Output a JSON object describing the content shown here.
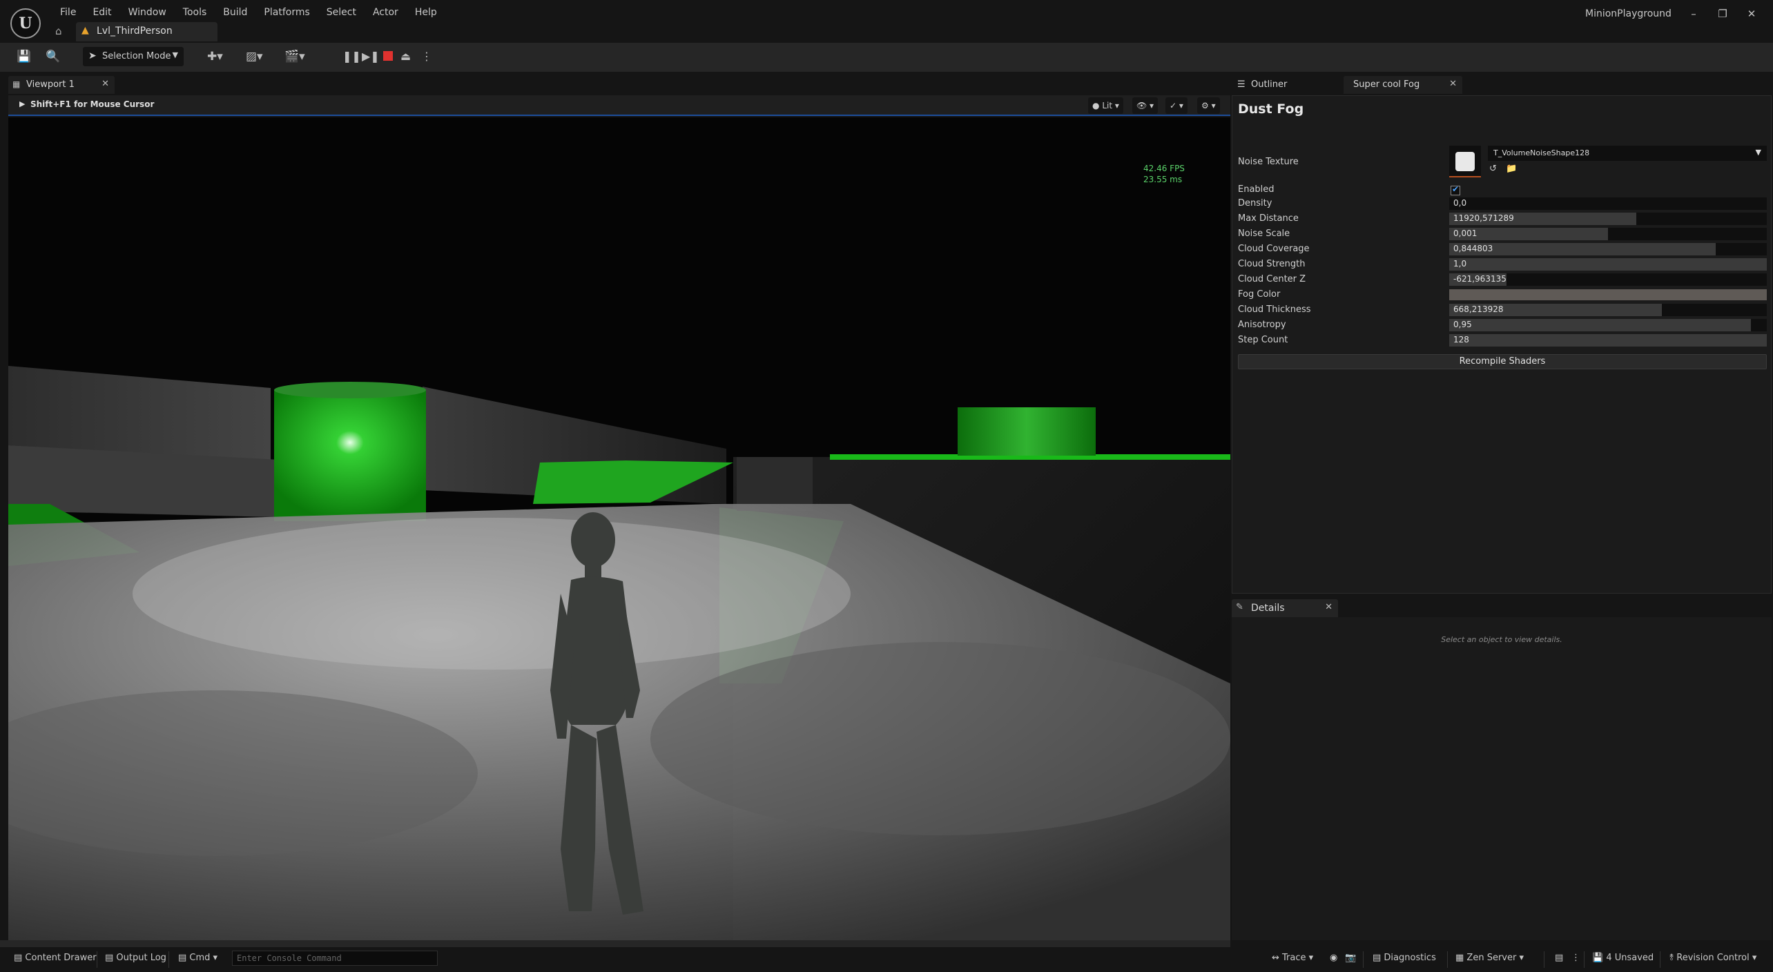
{
  "menu": [
    "File",
    "Edit",
    "Window",
    "Tools",
    "Build",
    "Platforms",
    "Select",
    "Actor",
    "Help"
  ],
  "app_name": "MinionPlayground",
  "level_tab": "Lvl_ThirdPerson",
  "toolbar": {
    "selection_mode": "Selection Mode"
  },
  "viewport": {
    "tab_label": "Viewport 1",
    "hint": "Shift+F1 for Mouse Cursor",
    "view_mode": "Lit",
    "fps": "42.46 FPS",
    "ms": "23.55 ms"
  },
  "right_panel": {
    "tabs": [
      "Outliner",
      "Super cool Fog"
    ],
    "title": "Dust Fog",
    "noise_texture": {
      "label": "Noise Texture",
      "value": "T_VolumeNoiseShape128"
    },
    "enabled_label": "Enabled",
    "properties": [
      {
        "label": "Density",
        "value": "0,0",
        "fill": 0.0
      },
      {
        "label": "Max Distance",
        "value": "11920,571289",
        "fill": 0.59
      },
      {
        "label": "Noise Scale",
        "value": "0,001",
        "fill": 0.5
      },
      {
        "label": "Cloud Coverage",
        "value": "0,844803",
        "fill": 0.84
      },
      {
        "label": "Cloud Strength",
        "value": "1,0",
        "fill": 1.0
      },
      {
        "label": "Cloud Center Z",
        "value": "-621,963135",
        "fill": 0.18
      },
      {
        "label": "Fog Color",
        "value": "",
        "fill": 0.0
      },
      {
        "label": "Cloud Thickness",
        "value": "668,213928",
        "fill": 0.67
      },
      {
        "label": "Anisotropy",
        "value": "0,95",
        "fill": 0.95
      },
      {
        "label": "Step Count",
        "value": "128",
        "fill": 1.0
      }
    ],
    "fog_color": "#5f5a56",
    "recompile_label": "Recompile Shaders"
  },
  "details": {
    "tab_label": "Details",
    "hint": "Select an object to view details."
  },
  "statusbar": {
    "content_drawer": "Content Drawer",
    "output_log": "Output Log",
    "cmd": "Cmd",
    "console_placeholder": "Enter Console Command",
    "trace": "Trace",
    "diagnostics": "Diagnostics",
    "zen_server": "Zen Server",
    "unsaved": "4 Unsaved",
    "revision_control": "Revision Control"
  },
  "colors": {
    "accent_blue": "#1d4e9b",
    "stop_red": "#e0322f",
    "fps_green": "#5bd36a",
    "warning_orange": "#e8a32c"
  }
}
